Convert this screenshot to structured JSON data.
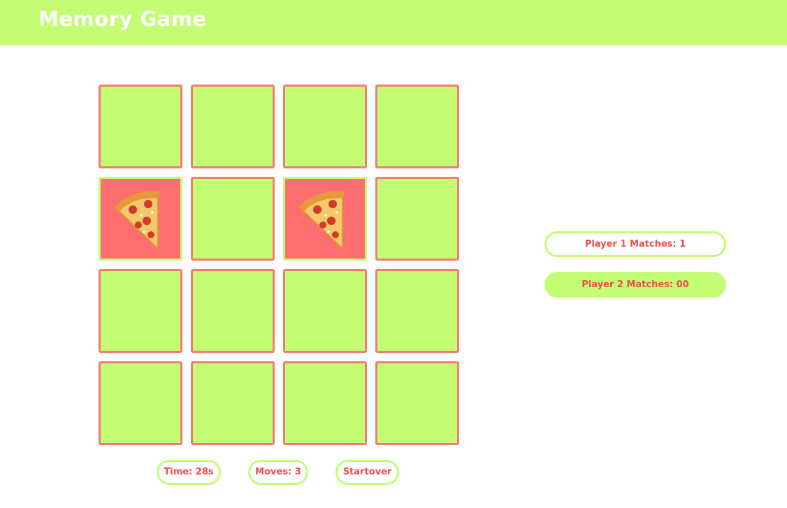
{
  "header": {
    "title": "Memory Game"
  },
  "colors": {
    "accent_green": "#c3fd74",
    "accent_red": "#f57b72",
    "text_red": "#ee4b4e",
    "card_face": "#ff6e6e"
  },
  "board": {
    "rows": 4,
    "cols": 4,
    "cards": [
      {
        "state": "hidden"
      },
      {
        "state": "hidden"
      },
      {
        "state": "hidden"
      },
      {
        "state": "hidden"
      },
      {
        "state": "flipped",
        "icon": "pizza-icon"
      },
      {
        "state": "hidden"
      },
      {
        "state": "flipped",
        "icon": "pizza-icon"
      },
      {
        "state": "hidden"
      },
      {
        "state": "hidden"
      },
      {
        "state": "hidden"
      },
      {
        "state": "hidden"
      },
      {
        "state": "hidden"
      },
      {
        "state": "hidden"
      },
      {
        "state": "hidden"
      },
      {
        "state": "hidden"
      },
      {
        "state": "hidden"
      }
    ]
  },
  "scores": {
    "player1": "Player 1 Matches: 1",
    "player2": "Player 2 Matches: 00"
  },
  "stats": {
    "time": "Time: 28s",
    "moves": "Moves: 3",
    "restart": "Startover"
  }
}
